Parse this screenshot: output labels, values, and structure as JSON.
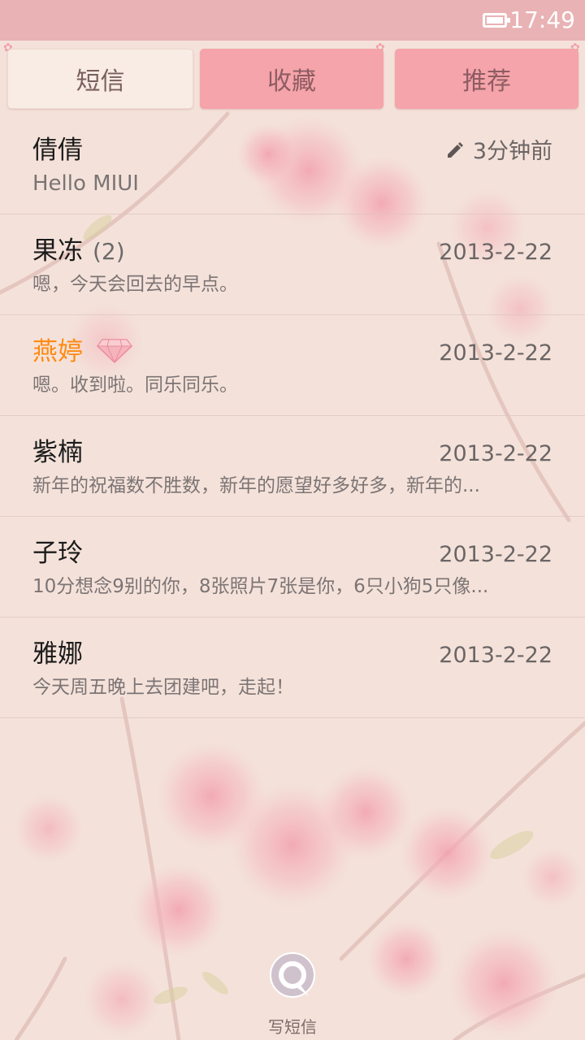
{
  "status_bar": {
    "time": "17:49",
    "battery_icon": "battery-icon"
  },
  "tabs": [
    {
      "label": "短信",
      "active": true
    },
    {
      "label": "收藏",
      "active": false
    },
    {
      "label": "推荐",
      "active": false
    }
  ],
  "messages": [
    {
      "name": "倩倩",
      "count": "",
      "time": "3分钟前",
      "preview": "Hello MIUI",
      "draft": true,
      "icon": "pencil-icon"
    },
    {
      "name": "果冻",
      "count": "(2)",
      "time": "2013-2-22",
      "preview": "嗯，今天会回去的早点。"
    },
    {
      "name": "燕婷",
      "count": "",
      "time": "2013-2-22",
      "preview": "嗯。收到啦。同乐同乐。",
      "highlight_color": "#ff8a12",
      "badge_icon": "diamond-icon"
    },
    {
      "name": "紫楠",
      "count": "",
      "time": "2013-2-22",
      "preview": "新年的祝福数不胜数，新年的愿望好多好多，新年的..."
    },
    {
      "name": "子玲",
      "count": "",
      "time": "2013-2-22",
      "preview": "10分想念9别的你，8张照片7张是你，6只小狗5只像..."
    },
    {
      "name": "雅娜",
      "count": "",
      "time": "2013-2-22",
      "preview": "今天周五晚上去团建吧，走起！"
    }
  ],
  "compose": {
    "label": "写短信",
    "icon": "compose-message-icon"
  },
  "colors": {
    "status_bar": "#e9b2b4",
    "tab_active": "#f8ece4",
    "tab_inactive": "#f4a4aa",
    "accent_name": "#ff8a12"
  }
}
